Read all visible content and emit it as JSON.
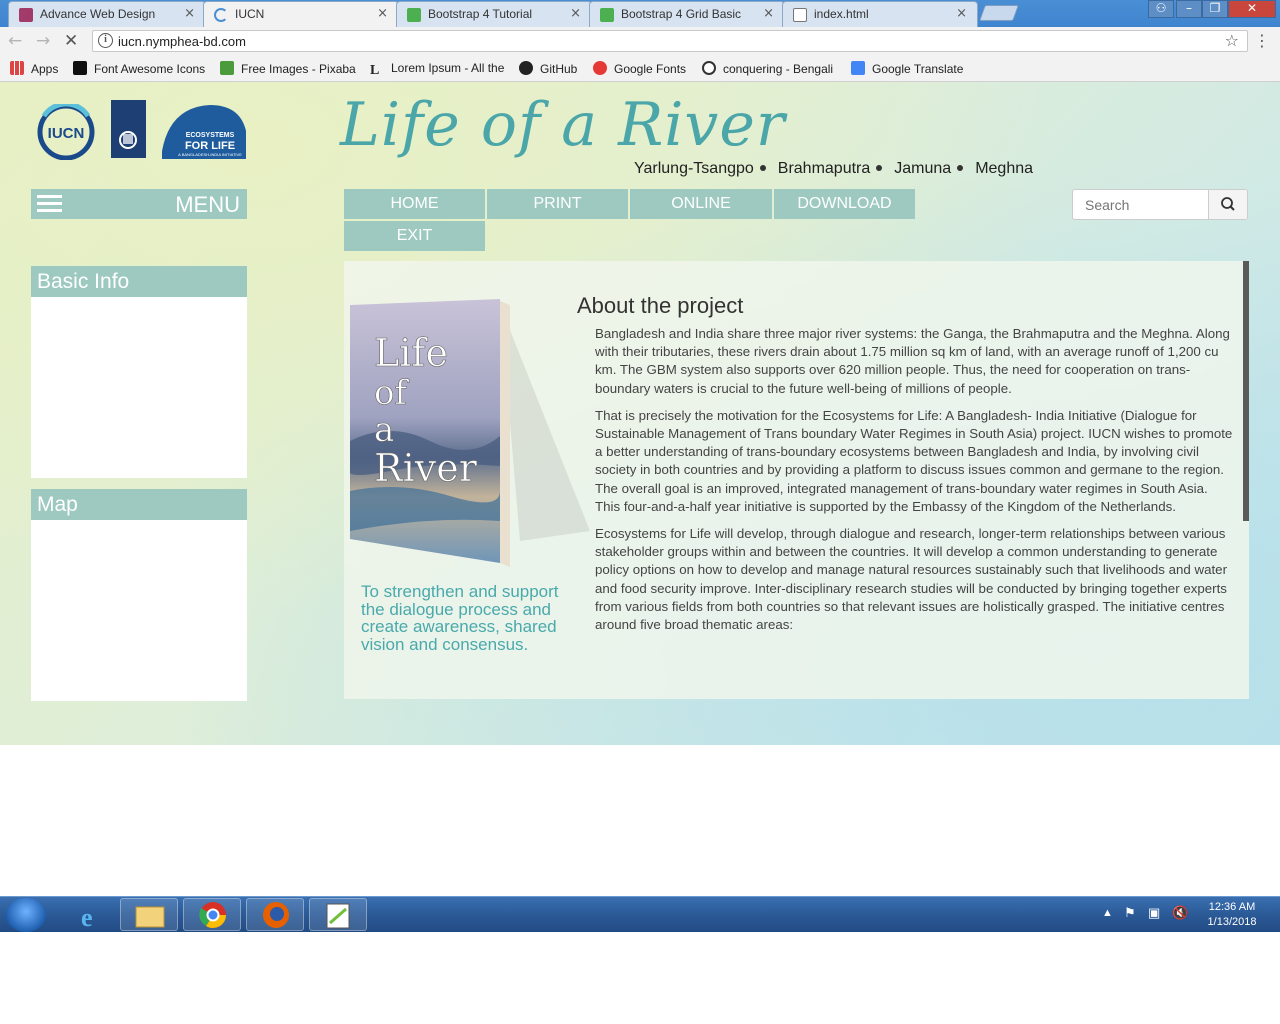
{
  "browser": {
    "tabs": [
      {
        "title": "Advance Web Design",
        "close": "×"
      },
      {
        "title": "IUCN",
        "close": "×"
      },
      {
        "title": "Bootstrap 4 Tutorial",
        "close": "×"
      },
      {
        "title": "Bootstrap 4 Grid Basic",
        "close": "×"
      },
      {
        "title": "index.html",
        "close": "×"
      }
    ],
    "url": "iucn.nymphea-bd.com",
    "bookmarks": [
      "Apps",
      "Font Awesome Icons",
      "Free Images - Pixabay",
      "Lorem Ipsum - All the",
      "GitHub",
      "Google Fonts",
      "conquering - Bengali",
      "Google Translate"
    ]
  },
  "site": {
    "title": "Life of a River",
    "rivers": [
      "Yarlung-Tsangpo",
      "Brahmaputra",
      "Jamuna",
      "Meghna"
    ],
    "menu_label": "MENU",
    "nav": [
      "HOME",
      "PRINT",
      "ONLINE",
      "DOWNLOAD",
      "EXIT"
    ],
    "search_placeholder": "Search",
    "panels": [
      "Basic Info",
      "Map"
    ],
    "book_title": [
      "Life",
      "of",
      "a",
      "River"
    ],
    "tagline": "To strengthen and support the dialogue process and create awareness, shared vision and consensus.",
    "logo_text": {
      "iucn": "IUCN",
      "efl": "ECOSYSTEMS FOR LIFE",
      "efl_sub": "A BANGLADESH-INDIA INITIATIVE"
    }
  },
  "about": {
    "title": "About the project",
    "p1": "Bangladesh and India share three major river systems: the Ganga, the Brahmaputra and the Meghna. Along with their tributaries, these rivers drain about 1.75 million sq km of land, with an average runoff of 1,200 cu km. The GBM system also supports over 620 million people. Thus, the need for cooperation on trans-boundary waters is crucial to the future well-being of millions of people.",
    "p2": "That is precisely the motivation for the Ecosystems for Life: A Bangladesh- India Initiative (Dialogue for Sustainable Management of Trans boundary Water Regimes in South Asia) project. IUCN wishes to promote a better understanding of trans-boundary ecosystems between Bangladesh and India, by involving civil society in both countries and by providing a platform to discuss issues common and germane to the region. The overall goal is an improved, integrated management of trans-boundary water regimes in South Asia. This four-and-a-half year initiative is supported by the Embassy of the Kingdom of the Netherlands.",
    "p3": "Ecosystems for Life will develop, through dialogue and research, longer-term relationships between various stakeholder groups within and between the countries. It will develop a common understanding to generate policy options on how to develop and manage natural resources sustainably such that livelihoods and water and food security improve. Inter-disciplinary research studies will be conducted by bringing together experts from various fields from both countries so that relevant issues are holistically grasped. The initiative centres around five broad thematic areas:"
  },
  "taskbar": {
    "time": "12:36 AM",
    "date": "1/13/2018"
  },
  "colors": {
    "accent": "#9dc9c0",
    "title": "#4aa6a8"
  }
}
